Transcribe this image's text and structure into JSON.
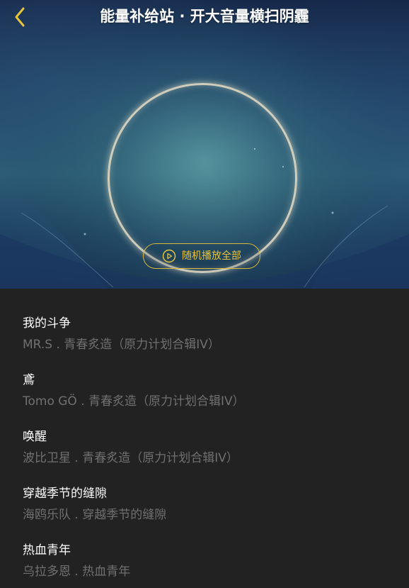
{
  "header": {
    "title": "能量补给站 · 开大音量横扫阴霾",
    "back_icon": "chevron-left-icon",
    "accent_color": "#e8c43c"
  },
  "hero": {
    "shuffle_label": "随机播放全部",
    "shuffle_icon": "play-circle-icon"
  },
  "songs": [
    {
      "title": "我的斗争",
      "meta": "MR.S . 青春炙造（原力计划合辑IV）"
    },
    {
      "title": "鳶",
      "meta": "Tomo GÖ . 青春炙造（原力计划合辑IV）"
    },
    {
      "title": "唤醒",
      "meta": "波比卫星 . 青春炙造（原力计划合辑IV）"
    },
    {
      "title": "穿越季节的缝隙",
      "meta": "海鸥乐队 . 穿越季节的缝隙"
    },
    {
      "title": "热血青年",
      "meta": "乌拉多恩 . 热血青年"
    }
  ]
}
